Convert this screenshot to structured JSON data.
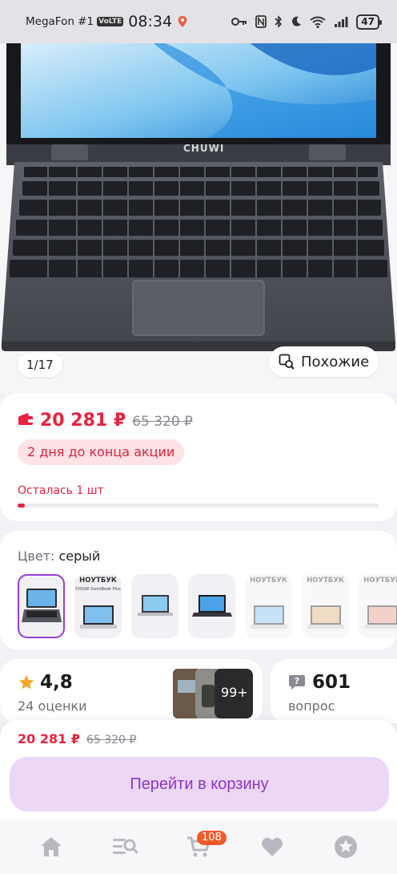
{
  "status_bar": {
    "carrier": "MegaFon #1",
    "volte": "VoLTE",
    "time": "08:34",
    "battery": "47"
  },
  "gallery": {
    "counter": "1/17",
    "similar_label": "Похожие",
    "laptop_brand": "CHUWI"
  },
  "price": {
    "current": "20 281 ₽",
    "old": "65 320 ₽",
    "promo": "2 дня до конца акции",
    "stock_label": "Осталась 1 шт",
    "stock_level": 0.02,
    "accent": "#e8223f"
  },
  "color": {
    "label": "Цвет:",
    "value": "серый",
    "swatch_badge": "НОУТБУК",
    "swatch_sub": "CHUWI GemiBook Plus"
  },
  "rating": {
    "value": "4,8",
    "count_label": "24 оценки",
    "photos_more": "99+"
  },
  "questions": {
    "count": "601",
    "label": "вопрос"
  },
  "cart": {
    "price_now": "20 281 ₽",
    "price_old": "65 320 ₽",
    "button": "Перейти в корзину",
    "accent": "#8e35c9"
  },
  "nav": {
    "cart_badge": "108",
    "items": [
      "home-icon",
      "catalog-search-icon",
      "cart-icon",
      "favorites-icon",
      "profile-star-icon"
    ]
  }
}
